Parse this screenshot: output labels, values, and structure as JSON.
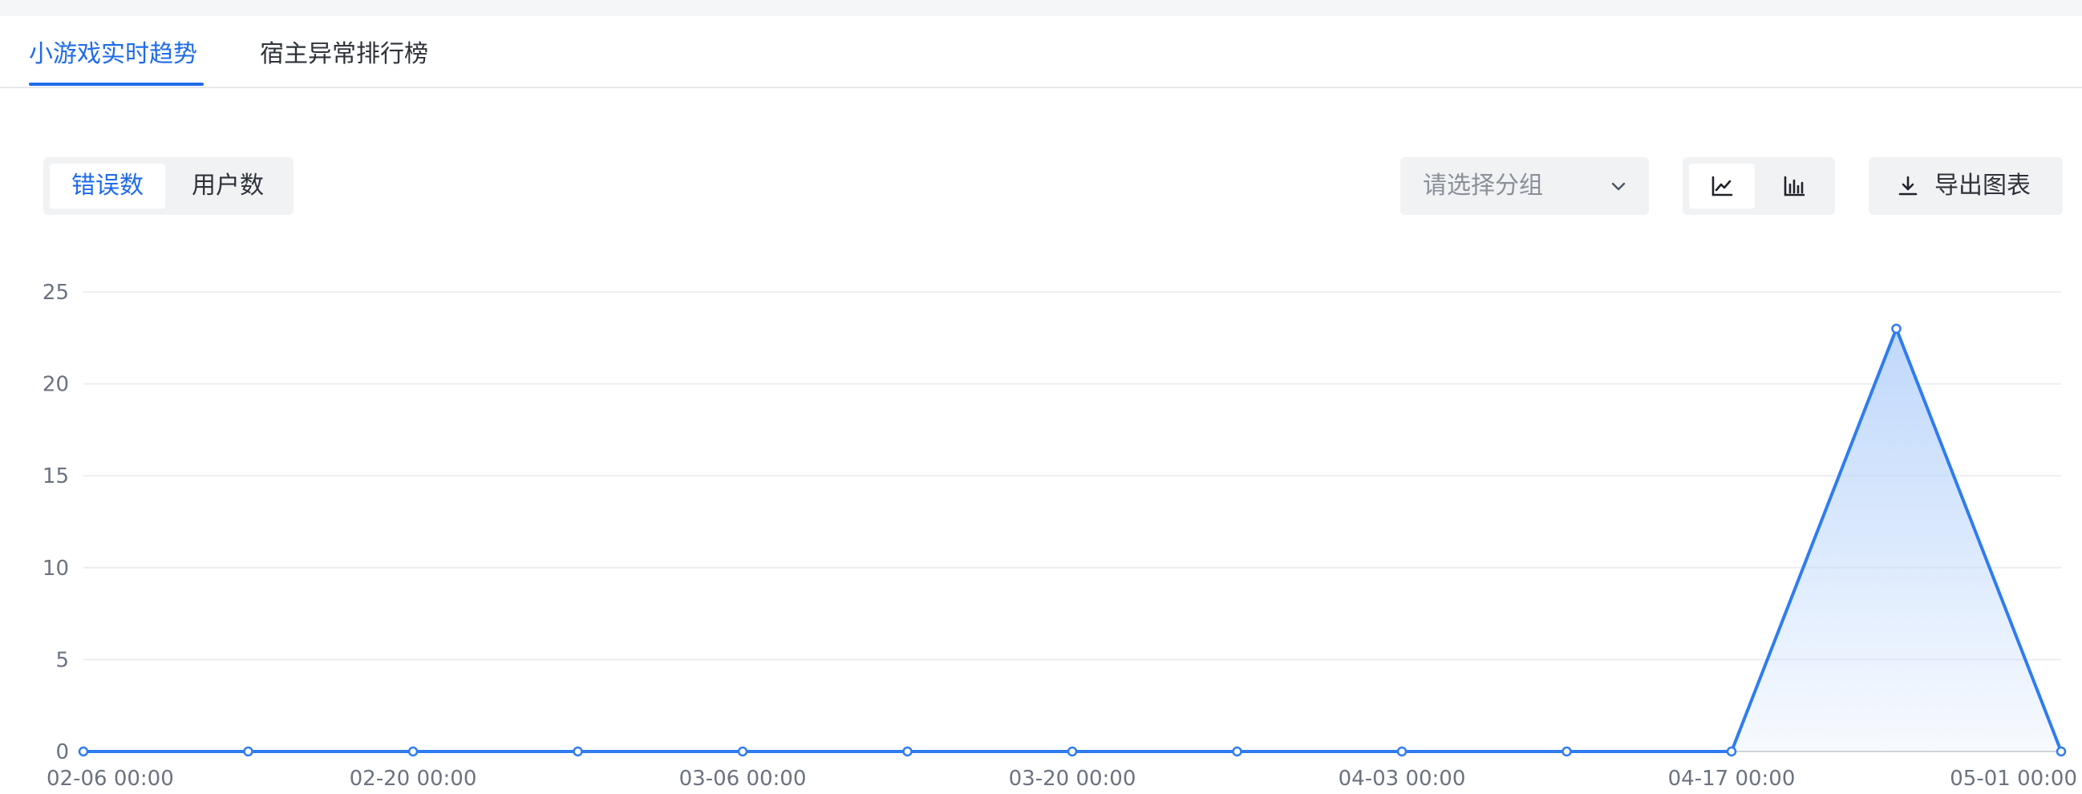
{
  "tabs": [
    {
      "label": "小游戏实时趋势",
      "active": true
    },
    {
      "label": "宿主异常排行榜",
      "active": false
    }
  ],
  "toolbar": {
    "metric_options": [
      "错误数",
      "用户数"
    ],
    "active_metric": "错误数",
    "group_placeholder": "请选择分组",
    "chart_types": [
      "line-chart-icon",
      "bar-chart-icon"
    ],
    "active_chart_type": "line-chart-icon",
    "export_label": "导出图表"
  },
  "colors": {
    "accent": "#1f6bea",
    "series_line": "#2f7cf0",
    "area_fill": "#bcd6fb"
  },
  "chart_data": {
    "type": "area",
    "ylim": [
      0,
      25
    ],
    "y_ticks": [
      0,
      5,
      10,
      15,
      20,
      25
    ],
    "x_tick_labels": [
      "02-06 00:00",
      "02-20 00:00",
      "03-06 00:00",
      "03-20 00:00",
      "04-03 00:00",
      "04-17 00:00",
      "05-01 00:00"
    ],
    "x": [
      "02-06",
      "02-13",
      "02-20",
      "02-27",
      "03-06",
      "03-13",
      "03-20",
      "03-27",
      "04-03",
      "04-10",
      "04-17",
      "04-24",
      "05-01"
    ],
    "series": [
      {
        "values": [
          0,
          0,
          0,
          0,
          0,
          0,
          0,
          0,
          0,
          0,
          0,
          23,
          0
        ]
      }
    ],
    "grid": true,
    "legend": "none"
  }
}
